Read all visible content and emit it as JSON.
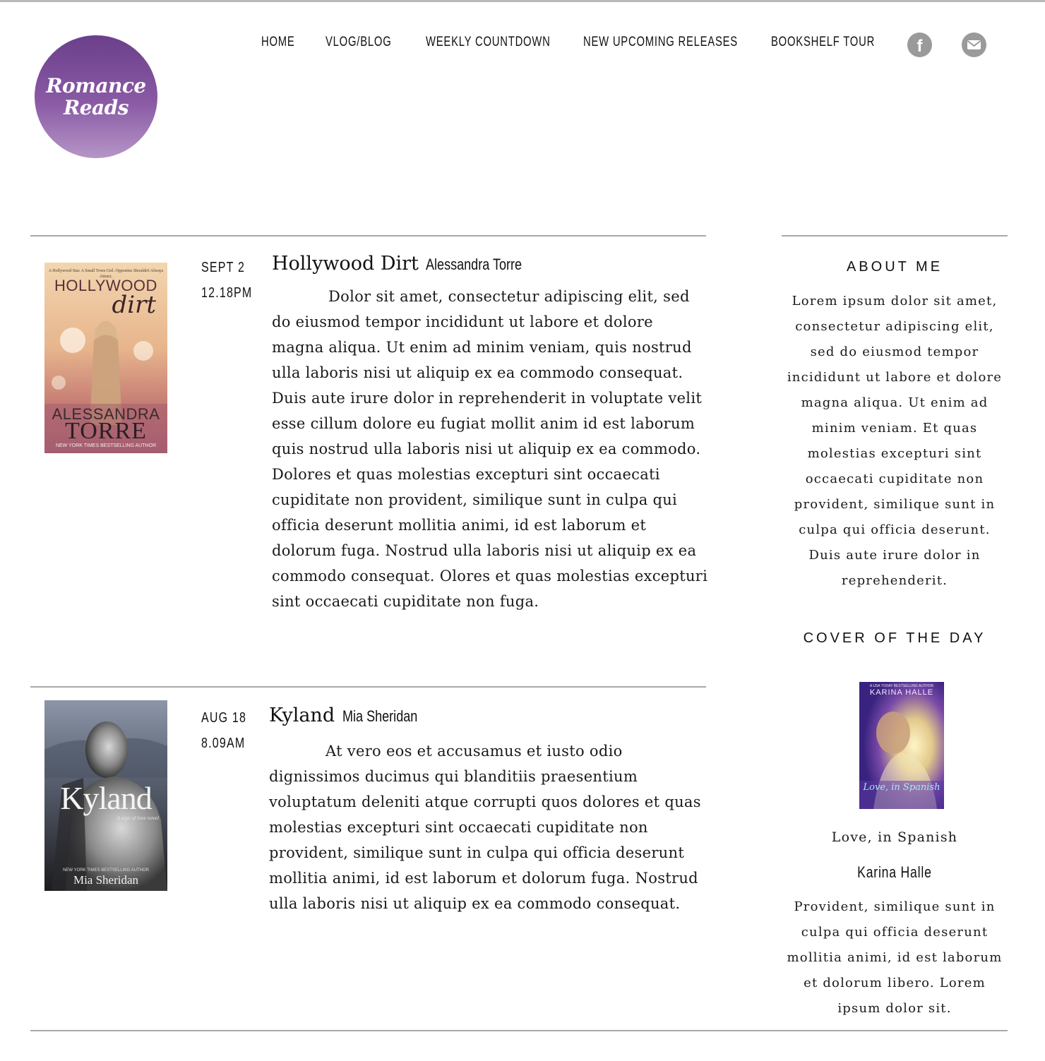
{
  "logo": {
    "line1": "Romance",
    "line2": "Reads"
  },
  "nav": {
    "items": [
      "HOME",
      "VLOG/BLOG",
      "WEEKLY COUNTDOWN",
      "NEW UPCOMING RELEASES",
      "BOOKSHELF TOUR"
    ],
    "facebook_icon": "facebook-icon",
    "email_icon": "email-icon"
  },
  "posts": [
    {
      "date": "SEPT 2",
      "time": "12.18PM",
      "title": "Hollywood Dirt",
      "author": "Alessandra Torre",
      "cover": {
        "tagline": "A Hollywood Star. A Small Town Girl. Opposites Shouldn't Always Attract.",
        "title_top": "HOLLYWOOD",
        "title_script": "dirt",
        "author_first": "ALESSANDRA",
        "author_last": "TORRE",
        "byline": "NEW YORK TIMES BESTSELLING AUTHOR"
      },
      "body": "Dolor sit amet, consectetur adipiscing elit, sed do eiusmod tempor incididunt ut labore et dolore magna aliqua. Ut enim ad minim veniam, quis nostrud ulla laboris nisi ut aliquip ex ea commodo consequat. Duis aute irure dolor in reprehenderit in voluptate velit esse cillum dolore eu fugiat mollit anim id est laborum quis nostrud ulla laboris nisi ut aliquip ex ea commodo. Dolores et quas molestias excepturi sint occaecati cupiditate non provident, similique sunt in culpa qui officia deserunt mollitia animi, id est laborum et dolorum fuga. Nostrud ulla laboris nisi ut aliquip ex ea commodo consequat. Olores et quas molestias excepturi sint occaecati cupiditate non fuga."
    },
    {
      "date": "AUG 18",
      "time": "8.09AM",
      "title": "Kyland",
      "author": "Mia Sheridan",
      "cover": {
        "title": "Kyland",
        "subtitle": "A sign of love novel",
        "byline": "NEW YORK TIMES BESTSELLING AUTHOR",
        "author": "Mia Sheridan"
      },
      "body": "At vero eos et accusamus et iusto odio dignissimos ducimus qui blanditiis praesentium voluptatum deleniti atque corrupti quos dolores et quas molestias excepturi sint occaecati cupiditate non provident, similique sunt in culpa qui officia deserunt mollitia animi, id est laborum et dolorum fuga. Nostrud ulla laboris nisi ut aliquip ex ea commodo consequat."
    }
  ],
  "sidebar": {
    "about_heading": "ABOUT ME",
    "about_text": "Lorem ipsum dolor sit amet, consectetur adipiscing elit, sed do eiusmod tempor incididunt ut labore et dolore magna aliqua. Ut enim ad minim veniam. Et quas molestias excepturi sint occaecati cupiditate non provident, similique sunt in culpa qui officia deserunt. Duis aute irure dolor in reprehenderit.",
    "cover_heading": "COVER OF THE DAY",
    "cover_book": {
      "byline": "A USA TODAY BESTSELLING AUTHOR",
      "author_caps": "KARINA HALLE",
      "script_title": "Love, in Spanish"
    },
    "cover_title": "Love, in Spanish",
    "cover_author": "Karina Halle",
    "cover_text": "Provident, similique sunt in culpa qui officia deserunt mollitia animi, id est laborum et dolorum libero. Lorem ipsum dolor sit."
  },
  "colors": {
    "logo_purple": "#6b3f8a",
    "rule_gray": "#a8a8a8",
    "icon_gray": "#9a9a9a"
  }
}
